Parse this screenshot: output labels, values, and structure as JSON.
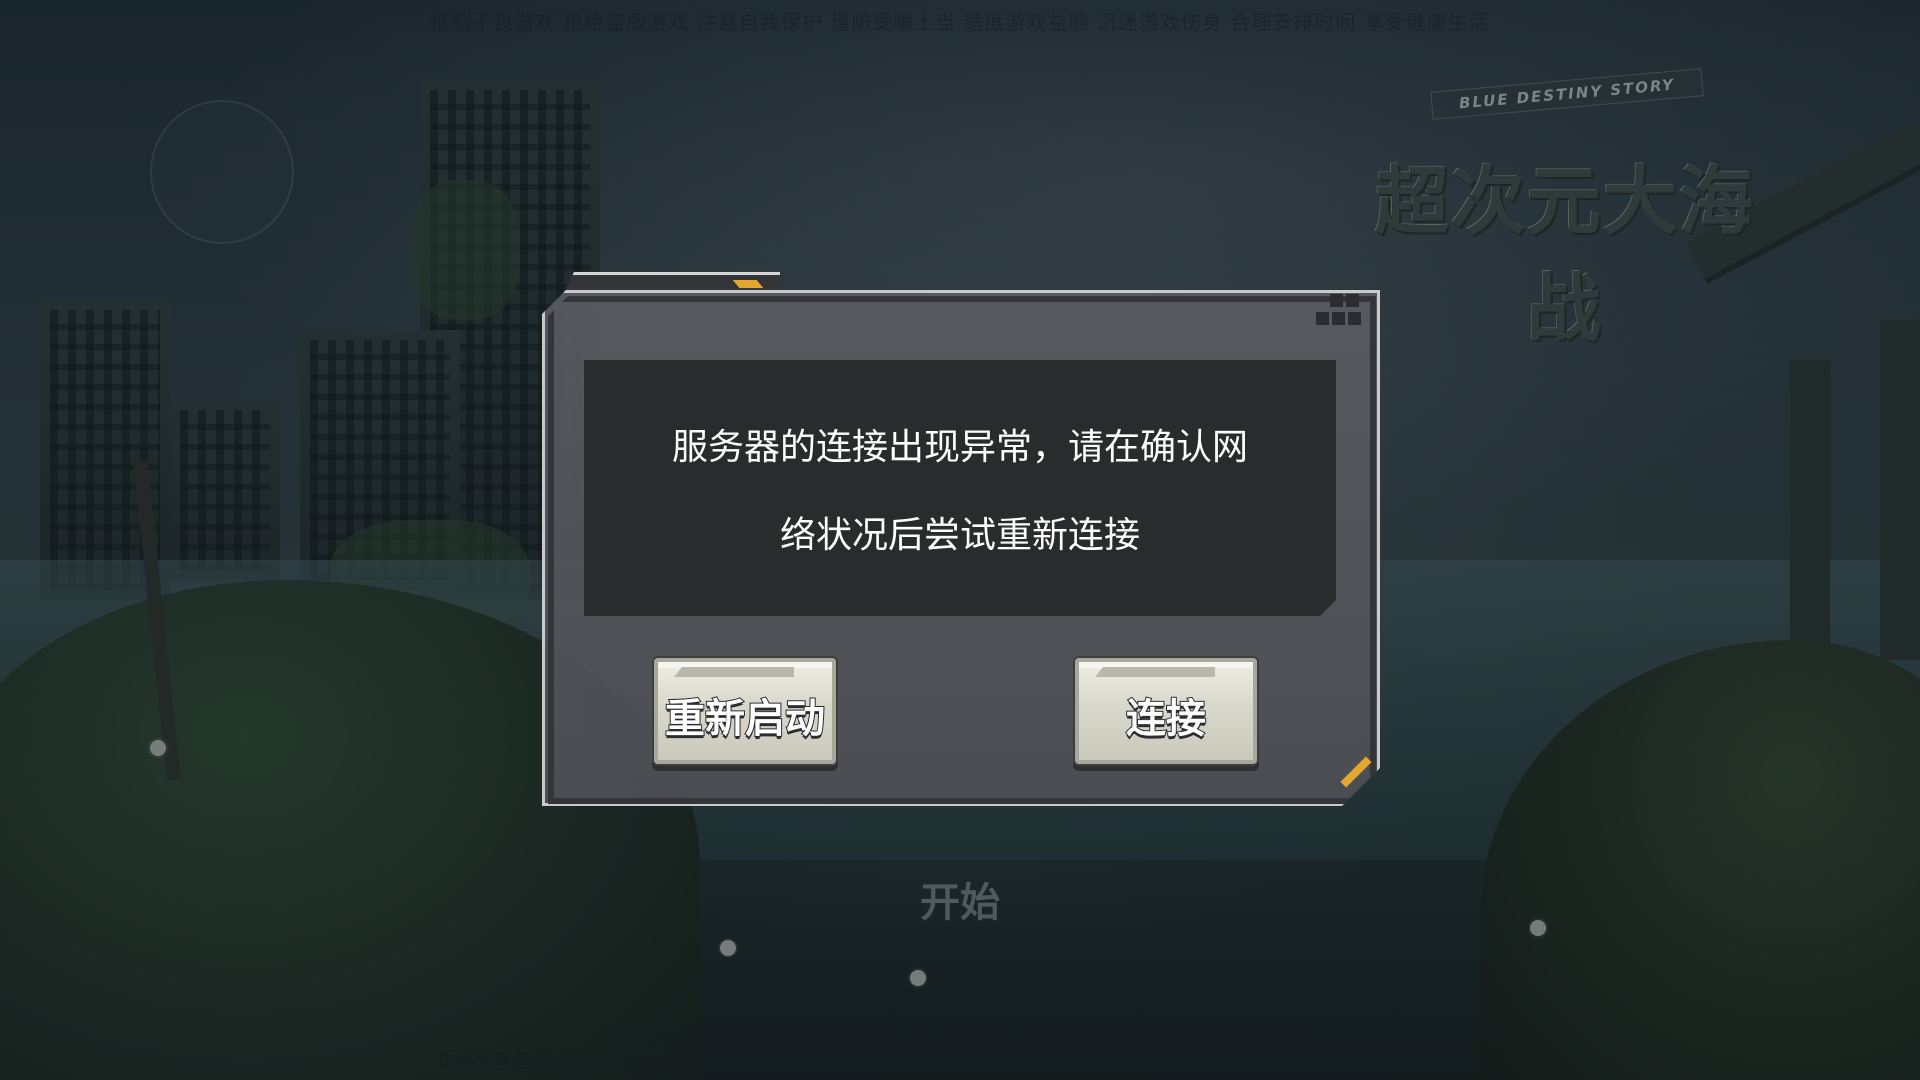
{
  "top_banner": "抵制不良游戏  拒绝盗版游戏  注意自我保护  谨防受骗上当  适度游戏益脑  沉迷游戏伤身  合理安排时间  享受健康生活",
  "logo": {
    "subtitle": "BLUE DESTINY STORY",
    "title": "超次元大海战"
  },
  "dialog": {
    "message": "服务器的连接出现异常，请在确认网\n络状况后尝试重新连接",
    "buttons": {
      "restart": "重新启动",
      "connect": "连接"
    }
  },
  "background": {
    "start_label": "开始",
    "copyright_line1": "著作权人:江苏甲子网络科技股份有限公司          出版单位:上海交通大学电子音像出版社有限公司",
    "copyright_line2": "审批文号:国新出审[2019]1119号   出版文号:沪新出科数[2018]243号   网络游戏出版物号ISBN 978-7-498-05710-5   备案号:1.3.1"
  },
  "colors": {
    "accent": "#e2a72e",
    "dialog_frame": "#d6d6d6",
    "dialog_fill": "#55575c",
    "message_bg": "#2a2b2d",
    "button_face": "#e3e2d6"
  }
}
